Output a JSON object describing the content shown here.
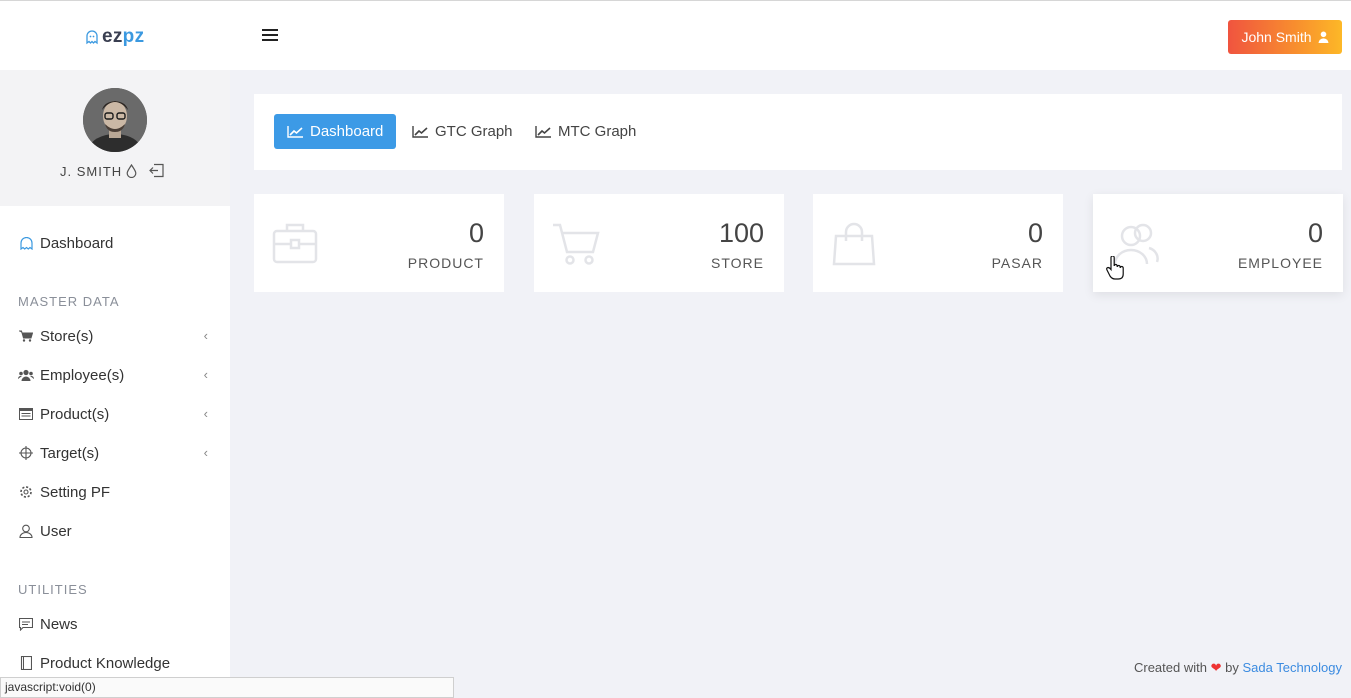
{
  "brand": {
    "part1": "ez",
    "part2": "pz"
  },
  "header": {
    "user_button": "John Smith"
  },
  "profile": {
    "name": "J. SMITH"
  },
  "sidebar": {
    "dashboard": "Dashboard",
    "section_master": "MASTER DATA",
    "section_utilities": "UTILITIES",
    "items": [
      {
        "label": "Store(s)",
        "icon": "cart-icon"
      },
      {
        "label": "Employee(s)",
        "icon": "users-icon"
      },
      {
        "label": "Product(s)",
        "icon": "list-icon"
      },
      {
        "label": "Target(s)",
        "icon": "crosshair-icon"
      },
      {
        "label": "Setting PF",
        "icon": "gear-icon"
      },
      {
        "label": "User",
        "icon": "user-icon"
      }
    ],
    "utilities": [
      {
        "label": "News",
        "icon": "news-icon"
      },
      {
        "label": "Product Knowledge",
        "icon": "book-icon"
      }
    ]
  },
  "tabs": [
    {
      "label": "Dashboard",
      "active": true
    },
    {
      "label": "GTC Graph",
      "active": false
    },
    {
      "label": "MTC Graph",
      "active": false
    }
  ],
  "stats": [
    {
      "value": "0",
      "caption": "PRODUCT",
      "icon": "briefcase-icon"
    },
    {
      "value": "100",
      "caption": "STORE",
      "icon": "cart-icon"
    },
    {
      "value": "0",
      "caption": "PASAR",
      "icon": "bag-icon"
    },
    {
      "value": "0",
      "caption": "EMPLOYEE",
      "icon": "users-icon"
    }
  ],
  "footer": {
    "prefix": "Created with",
    "by": "by",
    "company": "Sada Technology"
  },
  "status_bar": "javascript:void(0)",
  "colors": {
    "accent": "#3c9ae6",
    "user_button_start": "#f0543f",
    "user_button_end": "#fdb827",
    "background": "#f1f2f7"
  }
}
